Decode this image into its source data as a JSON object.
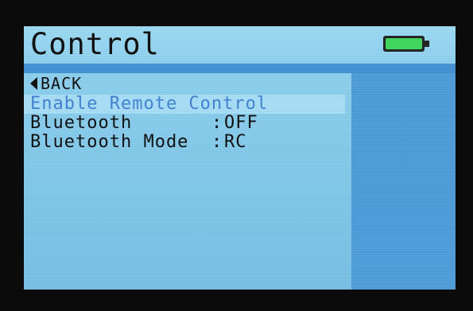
{
  "header": {
    "title": "Control",
    "battery_icon": "battery-full-icon",
    "battery_color": "#3cd65a"
  },
  "menu": {
    "back_label": "BACK",
    "items": [
      {
        "label": "Enable Remote Control",
        "value": "",
        "selected": true
      },
      {
        "label": "Bluetooth",
        "colon": ":",
        "value": "OFF"
      },
      {
        "label": "Bluetooth Mode",
        "colon": ":",
        "value": "RC"
      }
    ]
  },
  "colors": {
    "background": "#8fd1ee",
    "accent_bar": "#3f8fd2",
    "right_panel": "#4b9ad8",
    "selected_text": "#3d7fd1"
  }
}
